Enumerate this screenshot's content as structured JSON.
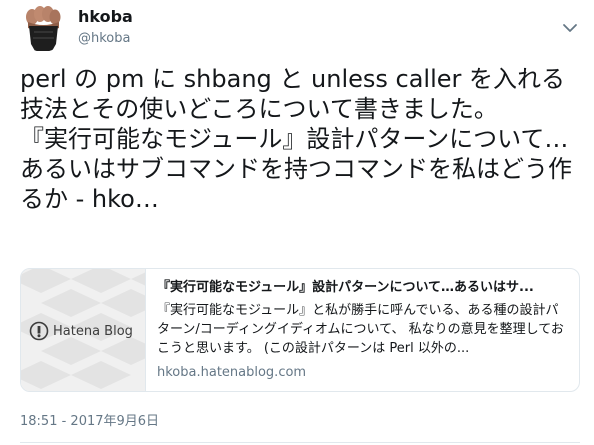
{
  "user": {
    "display_name": "hkoba",
    "screen_name": "@hkoba",
    "avatar_icon": "raised-fist-avatar"
  },
  "tweet": {
    "text": "perl の pm に shbang と unless caller を入れる技法とその使いどころについて書きました。\n『実行可能なモジュール』設計パターンについて…あるいはサブコマンドを持つコマンドを私はどう作るか - hko…",
    "timestamp": "18:51 - 2017年9月6日"
  },
  "card": {
    "thumbnail_label": "Hatena Blog",
    "title": "『実行可能なモジュール』設計パターンについて…あるいはサ...",
    "description": "『実行可能なモジュール』と私が勝手に呼んでいる、ある種の設計パターン/コーディングイディオムについて、 私なりの意見を整理しておこうと思います。 (この設計パターンは Perl 以外の...",
    "domain": "hkoba.hatenablog.com"
  },
  "icons": {
    "menu": "chevron-down-icon",
    "blog_logo": "hatena-blog-logo-icon"
  },
  "colors": {
    "text": "#14171a",
    "secondary_text": "#657786",
    "border": "#e1e8ed"
  }
}
